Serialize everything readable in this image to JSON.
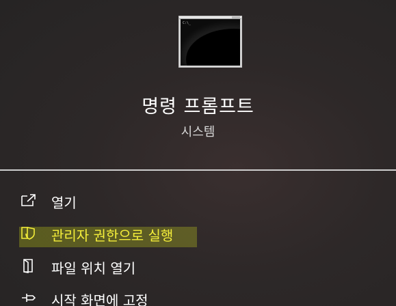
{
  "app": {
    "title": "명령 프롬프트",
    "subtitle": "시스템",
    "icon_prompt_text": "C:\\_"
  },
  "menu": {
    "items": [
      {
        "label": "열기",
        "icon": "open-icon"
      },
      {
        "label": "관리자 권한으로 실행",
        "icon": "shield-icon"
      },
      {
        "label": "파일 위치 열기",
        "icon": "file-location-icon"
      },
      {
        "label": "시작 화면에 고정",
        "icon": "pin-icon"
      }
    ]
  },
  "colors": {
    "background": "#2b2727",
    "text": "#ffffff",
    "highlight_text": "#f4ee3a",
    "highlight_band": "#9aa21a"
  }
}
